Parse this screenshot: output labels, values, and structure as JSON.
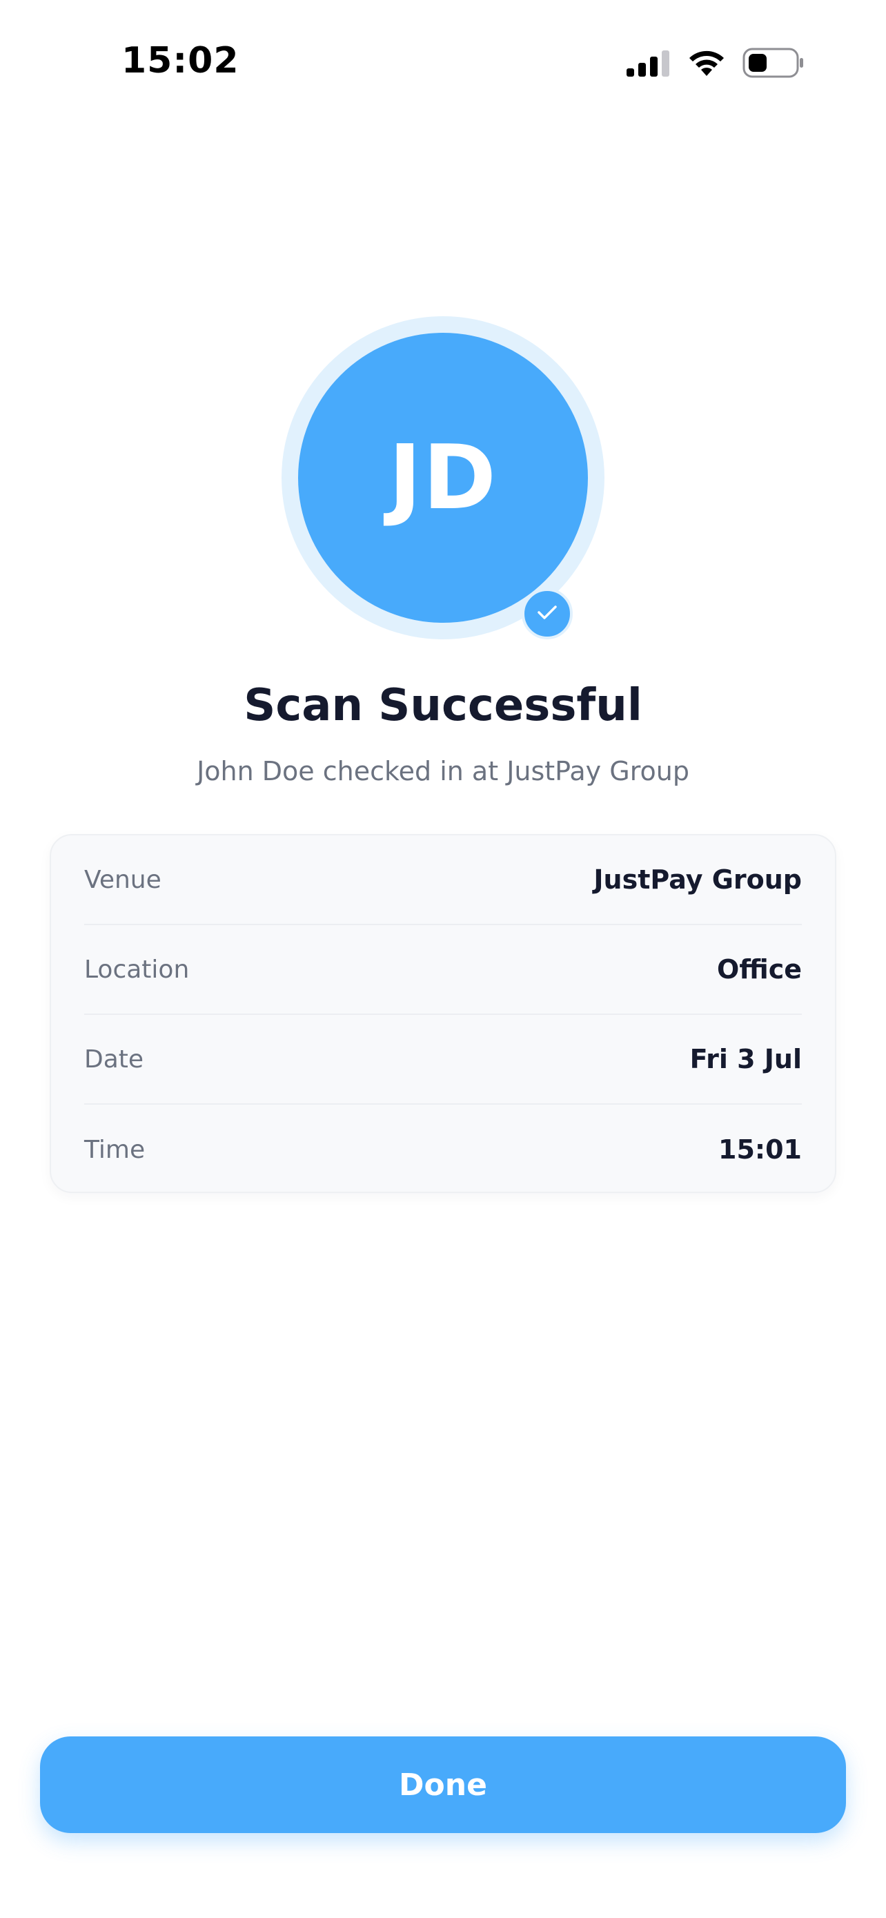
{
  "status_bar": {
    "time": "15:02",
    "icons": [
      "cellular-signal-icon",
      "wifi-icon",
      "battery-icon"
    ]
  },
  "avatar": {
    "initials": "JD",
    "badge_icon": "checkmark-icon"
  },
  "header": {
    "title": "Scan Successful",
    "subtitle": "John Doe checked in at JustPay Group"
  },
  "details": [
    {
      "label": "Venue",
      "value": "JustPay Group"
    },
    {
      "label": "Location",
      "value": "Office"
    },
    {
      "label": "Date",
      "value": "Fri 3 Jul"
    },
    {
      "label": "Time",
      "value": "15:01"
    }
  ],
  "actions": {
    "done_label": "Done"
  },
  "colors": {
    "accent": "#48aafb",
    "accent_light": "#e1f1fd",
    "title_text": "#151a2e",
    "muted_text": "#6b7280"
  }
}
